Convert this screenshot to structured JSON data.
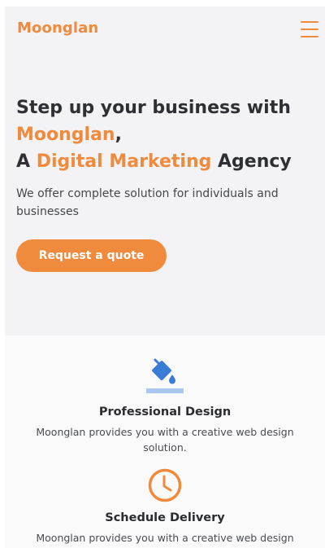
{
  "header": {
    "brand": "Moonglan",
    "menu_icon": "hamburger-menu-icon"
  },
  "hero": {
    "line1": "Step up your business with",
    "line2_accent": "Moonglan",
    "line2_rest": ",",
    "line3_pre": "A ",
    "line3_accent": "Digital Marketing",
    "line3_post": " Agency",
    "description": "We offer complete solution for individuals and businesses",
    "cta_label": "Request a quote"
  },
  "features": [
    {
      "icon": "paint-bucket-icon",
      "title": "Professional Design",
      "description": "Moonglan provides you with a creative web design solution."
    },
    {
      "icon": "clock-icon",
      "title": "Schedule Delivery",
      "description": "Moonglan provides you with a creative web design"
    }
  ],
  "colors": {
    "accent": "#f08a3c",
    "heading": "#2f3035",
    "icon_blue": "#3a7bd5"
  }
}
